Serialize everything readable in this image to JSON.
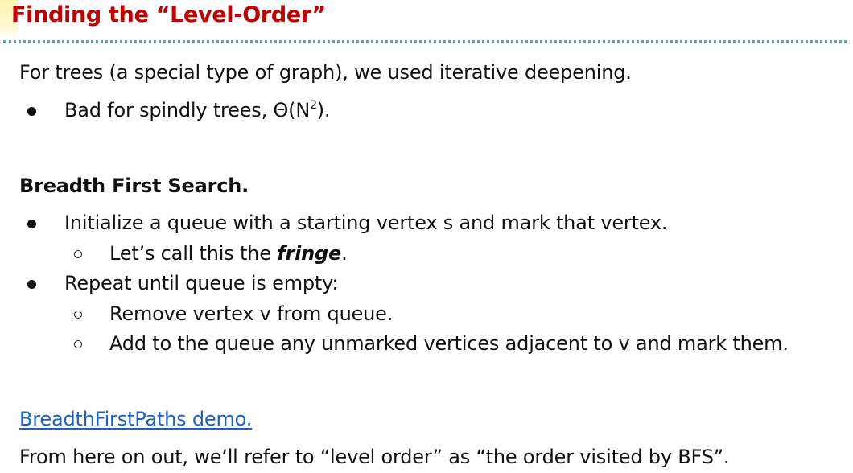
{
  "slide": {
    "title": "Finding the “Level-Order”",
    "intro": "For trees (a special type of graph), we used iterative deepening.",
    "intro_bullet": {
      "prefix": "Bad for spindly trees, Θ(N",
      "superscript": "2",
      "suffix": ")."
    },
    "bfs_heading": "Breadth First Search.",
    "bfs_steps": [
      "Initialize a queue with a starting vertex s and mark that vertex.",
      "Repeat until queue is empty:"
    ],
    "fringe_note": {
      "prefix": "Let’s call this the ",
      "emphasis": "fringe",
      "suffix": "."
    },
    "repeat_substeps": [
      "Remove vertex v from queue.",
      "Add to the queue any unmarked vertices adjacent to v and mark them."
    ],
    "demo_link": "BreadthFirstPaths demo.",
    "footer": "From here on out, we’ll refer to “level order” as “the order visited by BFS”."
  }
}
